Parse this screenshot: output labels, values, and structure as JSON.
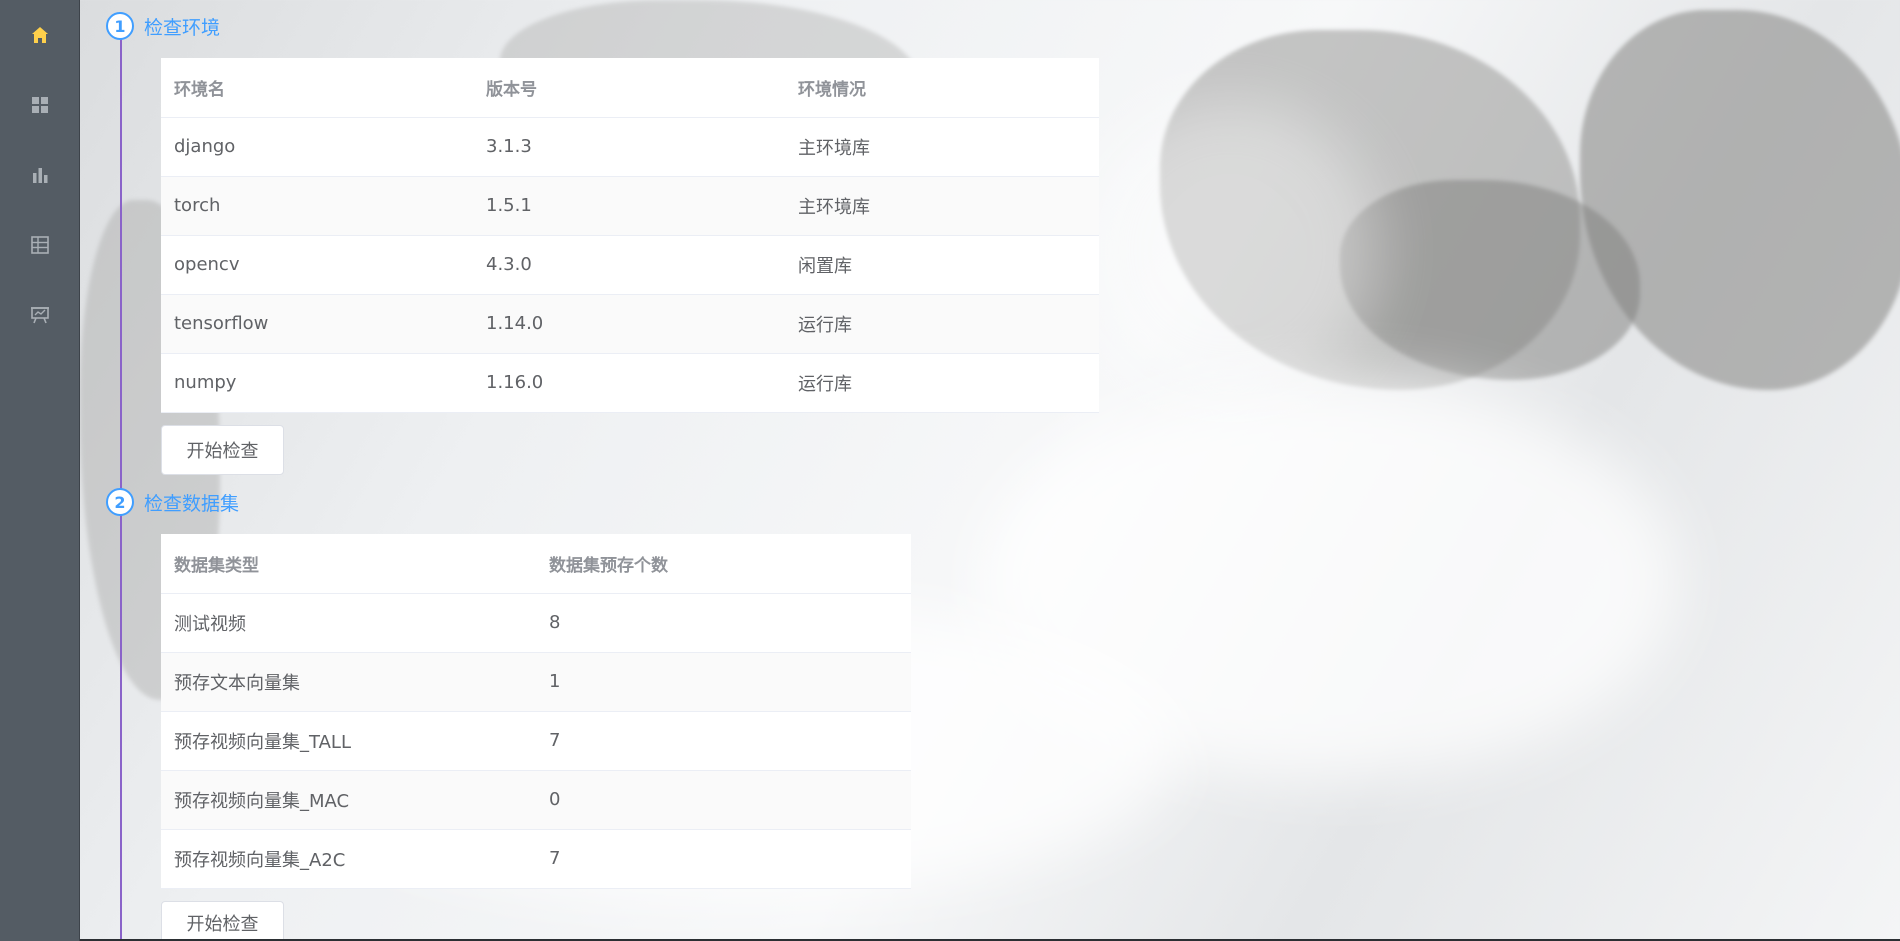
{
  "sidebar": {
    "items": [
      {
        "icon": "home-icon",
        "active": true
      },
      {
        "icon": "grid-icon",
        "active": false
      },
      {
        "icon": "bar-chart-icon",
        "active": false
      },
      {
        "icon": "table-icon",
        "active": false
      },
      {
        "icon": "presentation-icon",
        "active": false
      }
    ],
    "active_color": "#ffd04b",
    "icon_color": "#a9afb5"
  },
  "accent_color": "#409eff",
  "steps": [
    {
      "number": "1",
      "title": "检查环境",
      "columns": [
        "环境名",
        "版本号",
        "环境情况"
      ],
      "rows": [
        [
          "django",
          "3.1.3",
          "主环境库"
        ],
        [
          "torch",
          "1.5.1",
          "主环境库"
        ],
        [
          "opencv",
          "4.3.0",
          "闲置库"
        ],
        [
          "tensorflow",
          "1.14.0",
          "运行库"
        ],
        [
          "numpy",
          "1.16.0",
          "运行库"
        ]
      ],
      "button_label": "开始检查"
    },
    {
      "number": "2",
      "title": "检查数据集",
      "columns": [
        "数据集类型",
        "数据集预存个数"
      ],
      "rows": [
        [
          "测试视频",
          "8"
        ],
        [
          "预存文本向量集",
          "1"
        ],
        [
          "预存视频向量集_TALL",
          "7"
        ],
        [
          "预存视频向量集_MAC",
          "0"
        ],
        [
          "预存视频向量集_A2C",
          "7"
        ]
      ],
      "button_label": "开始检查"
    }
  ]
}
